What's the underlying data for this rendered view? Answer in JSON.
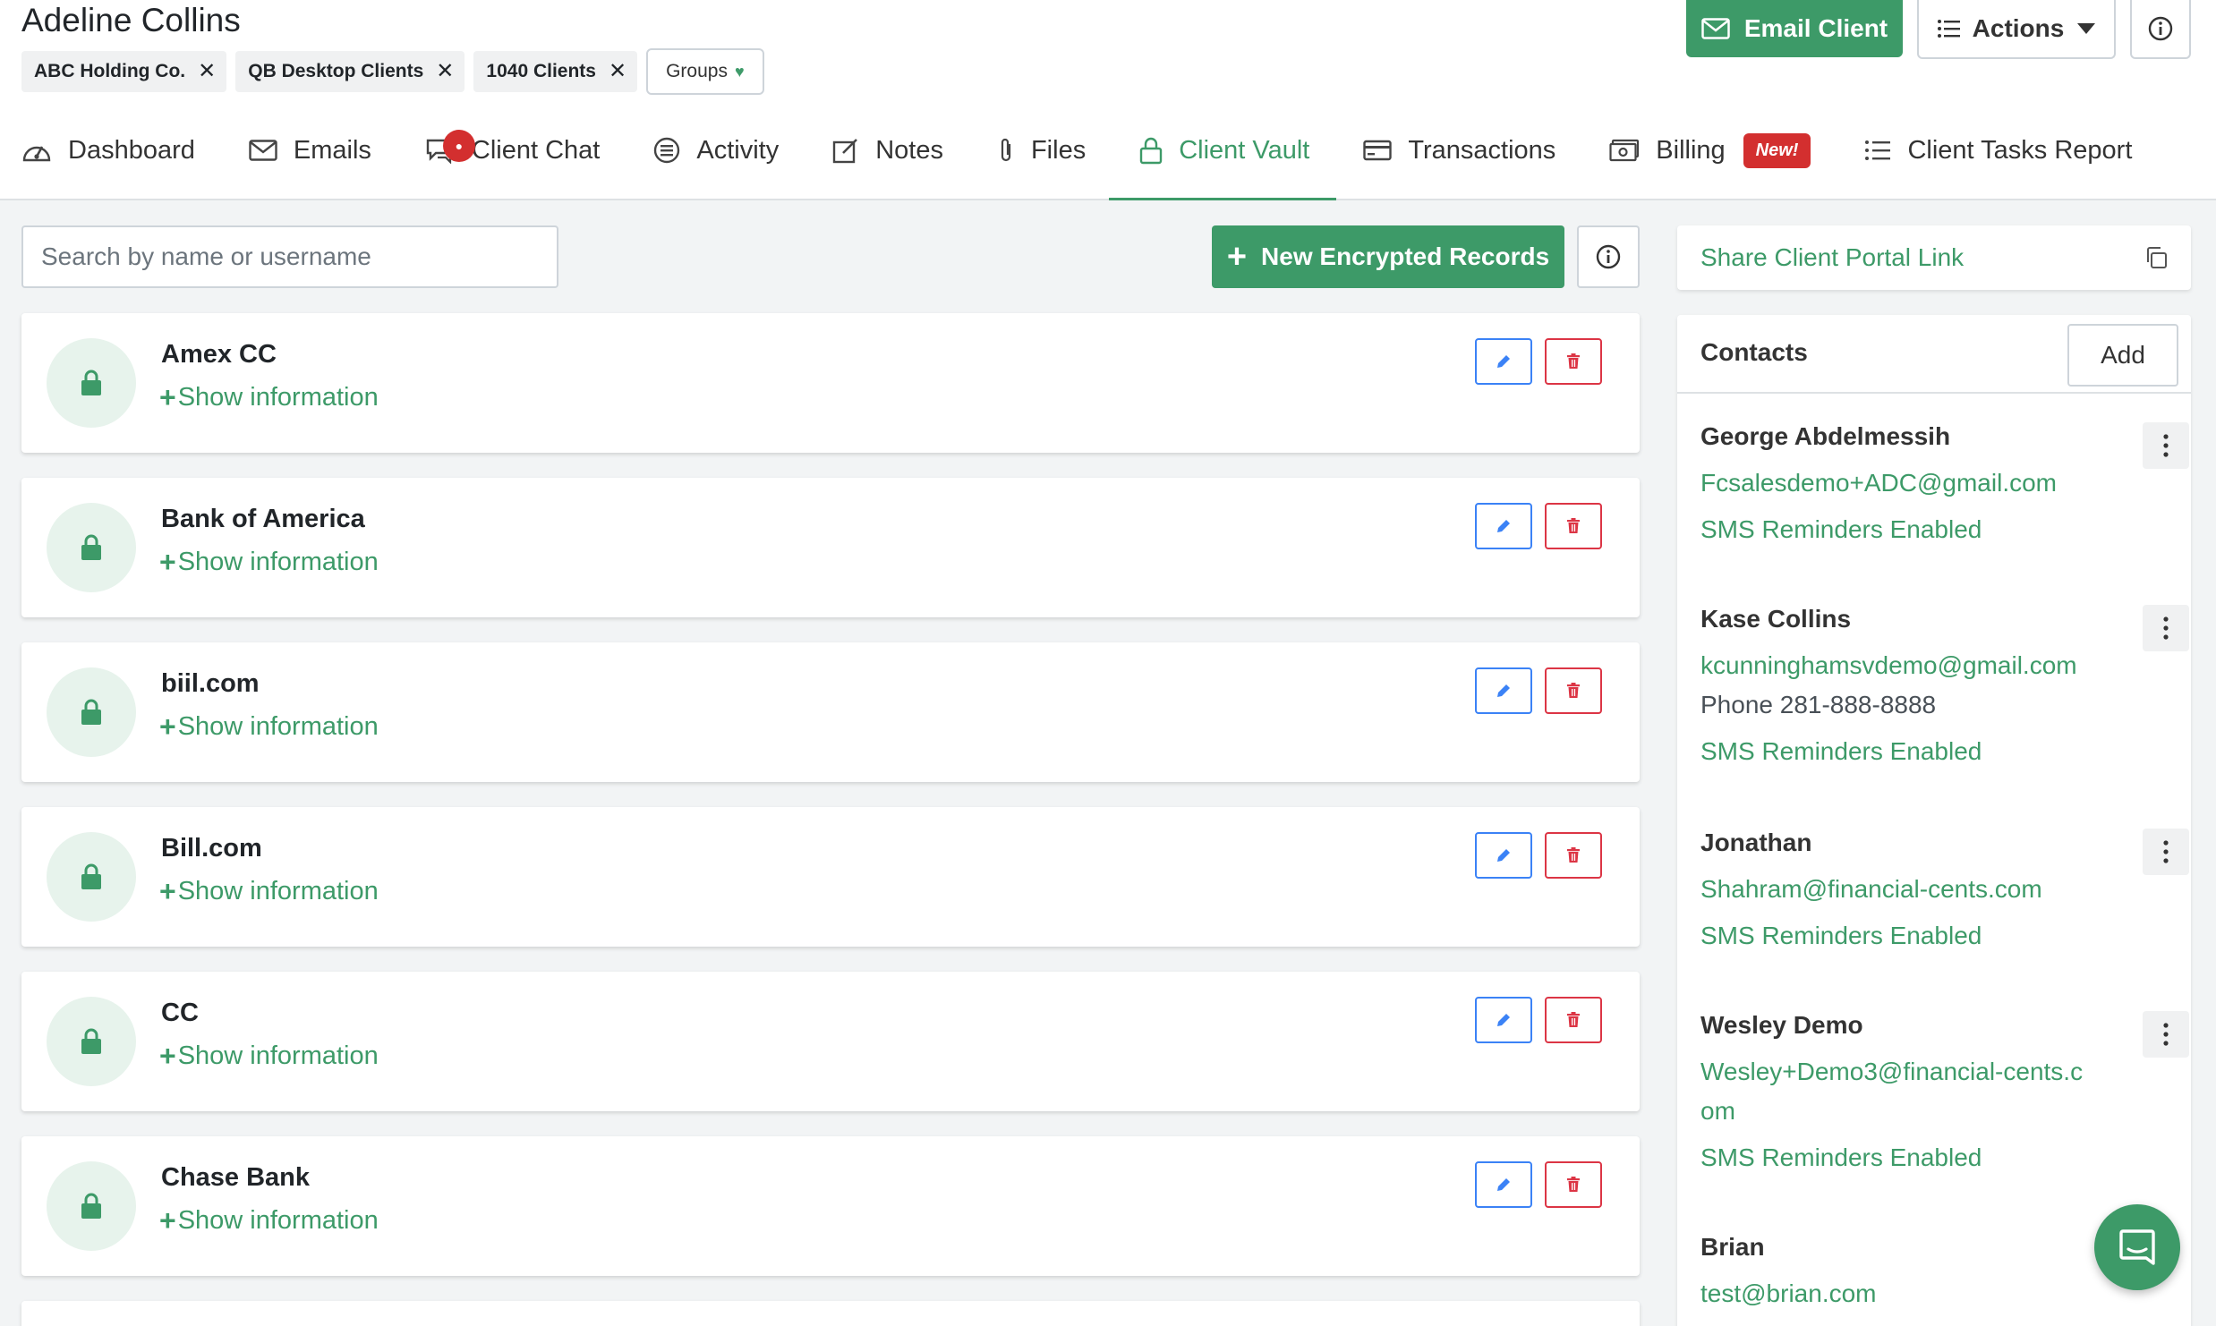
{
  "client": {
    "name": "Adeline Collins"
  },
  "tags": [
    "ABC Holding Co.",
    "QB Desktop Clients",
    "1040 Clients"
  ],
  "groups_label": "Groups",
  "actions": {
    "email_label": "Email Client",
    "actions_label": "Actions"
  },
  "tabs": [
    {
      "label": "Dashboard",
      "icon": "dashboard-icon"
    },
    {
      "label": "Emails",
      "icon": "envelope-icon"
    },
    {
      "label": "Client Chat",
      "icon": "chat-icon"
    },
    {
      "label": "Activity",
      "icon": "activity-icon"
    },
    {
      "label": "Notes",
      "icon": "notes-icon"
    },
    {
      "label": "Files",
      "icon": "paperclip-icon"
    },
    {
      "label": "Client Vault",
      "icon": "lock-icon",
      "active": true
    },
    {
      "label": "Transactions",
      "icon": "credit-card-icon"
    },
    {
      "label": "Billing",
      "icon": "money-icon",
      "badge": "New!"
    },
    {
      "label": "Client Tasks Report",
      "icon": "list-icon"
    }
  ],
  "search": {
    "placeholder": "Search by name or username"
  },
  "new_records_label": "New Encrypted Records",
  "records": [
    {
      "name": "Amex CC",
      "action": "Show information"
    },
    {
      "name": "Bank of America",
      "action": "Show information"
    },
    {
      "name": "biil.com",
      "action": "Show information"
    },
    {
      "name": "Bill.com",
      "action": "Show information"
    },
    {
      "name": "CC",
      "action": "Show information"
    },
    {
      "name": "Chase Bank",
      "action": "Show information"
    }
  ],
  "share_link_label": "Share Client Portal Link",
  "contacts": {
    "title": "Contacts",
    "add_label": "Add",
    "items": [
      {
        "name": "George Abdelmessih",
        "email": "Fcsalesdemo+ADC@gmail.com",
        "sms": "SMS Reminders Enabled"
      },
      {
        "name": "Kase Collins",
        "email": "kcunninghamsvdemo@gmail.com",
        "phone": "Phone 281-888-8888",
        "sms": "SMS Reminders Enabled"
      },
      {
        "name": "Jonathan",
        "email": "Shahram@financial-cents.com",
        "sms": "SMS Reminders Enabled"
      },
      {
        "name": "Wesley Demo",
        "email": "Wesley+Demo3@financial-cents.com",
        "sms": "SMS Reminders Enabled"
      },
      {
        "name": "Brian",
        "email": "test@brian.com"
      }
    ]
  },
  "colors": {
    "brand_green": "#3d9a68",
    "danger_red": "#dc3545",
    "edit_blue": "#3b82f6",
    "badge_red": "#d32f2f"
  }
}
